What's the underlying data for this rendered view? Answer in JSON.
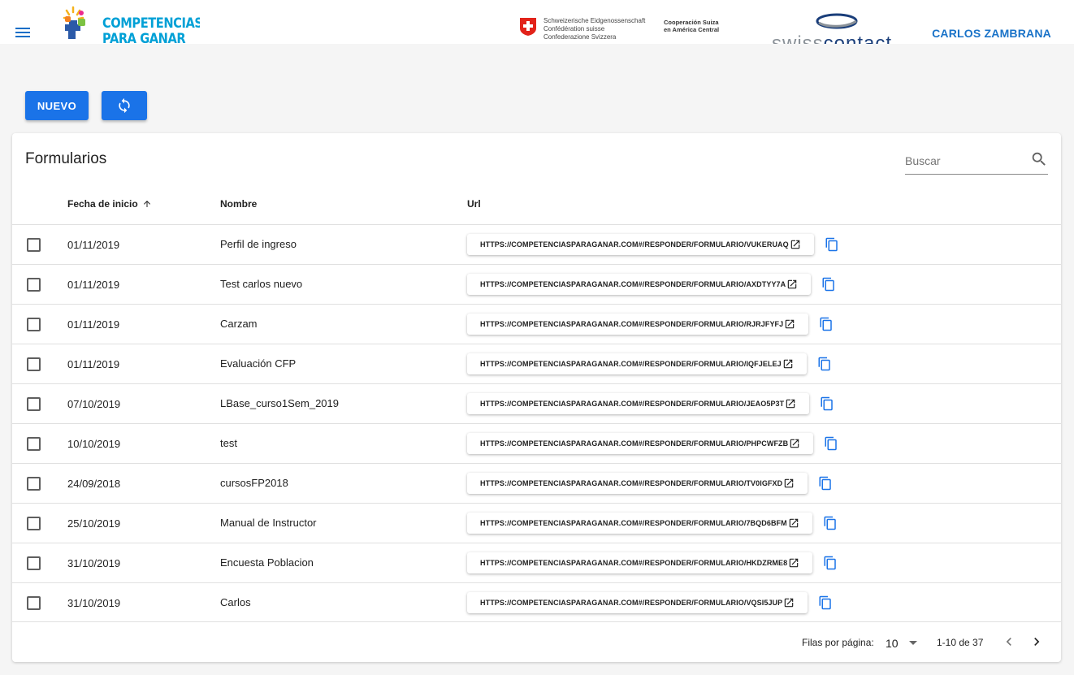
{
  "header": {
    "brand_line1": "COMPETENCIAS",
    "brand_line2": "PARA GANAR",
    "swiss_lines": [
      "Schweizerische Eidgenossenschaft",
      "Confédération suisse",
      "Confederazione Svizzera"
    ],
    "coop_lines": [
      "Cooperación Suiza",
      "en América Central"
    ],
    "swisscontact_a": "swiss",
    "swisscontact_b": "contact",
    "user_name": "CARLOS ZAMBRANA"
  },
  "toolbar": {
    "new_label": "NUEVO",
    "refresh_icon": "refresh-icon"
  },
  "card": {
    "title": "Formularios",
    "search_placeholder": "Buscar",
    "columns": [
      "Fecha de inicio",
      "Nombre",
      "Url"
    ],
    "sort": "ascending",
    "rows": [
      {
        "date": "01/11/2019",
        "name": "Perfil de ingreso",
        "url": "HTTPS://COMPETENCIASPARAGANAR.COM#/RESPONDER/FORMULARIO/VUKERUAQ"
      },
      {
        "date": "01/11/2019",
        "name": "Test carlos nuevo",
        "url": "HTTPS://COMPETENCIASPARAGANAR.COM#/RESPONDER/FORMULARIO/AXDTYY7A"
      },
      {
        "date": "01/11/2019",
        "name": "Carzam",
        "url": "HTTPS://COMPETENCIASPARAGANAR.COM#/RESPONDER/FORMULARIO/RJRJFYFJ"
      },
      {
        "date": "01/11/2019",
        "name": "Evaluación CFP",
        "url": "HTTPS://COMPETENCIASPARAGANAR.COM#/RESPONDER/FORMULARIO/IQFJELEJ"
      },
      {
        "date": "07/10/2019",
        "name": "LBase_curso1Sem_2019",
        "url": "HTTPS://COMPETENCIASPARAGANAR.COM#/RESPONDER/FORMULARIO/JEAO5P3T"
      },
      {
        "date": "10/10/2019",
        "name": "test",
        "url": "HTTPS://COMPETENCIASPARAGANAR.COM#/RESPONDER/FORMULARIO/PHPCWFZB"
      },
      {
        "date": "24/09/2018",
        "name": "cursosFP2018",
        "url": "HTTPS://COMPETENCIASPARAGANAR.COM#/RESPONDER/FORMULARIO/TV0IGFXD"
      },
      {
        "date": "25/10/2019",
        "name": "Manual de Instructor",
        "url": "HTTPS://COMPETENCIASPARAGANAR.COM#/RESPONDER/FORMULARIO/7BQD6BFM"
      },
      {
        "date": "31/10/2019",
        "name": "Encuesta Poblacion",
        "url": "HTTPS://COMPETENCIASPARAGANAR.COM#/RESPONDER/FORMULARIO/HKDZRME8"
      },
      {
        "date": "31/10/2019",
        "name": "Carlos",
        "url": "HTTPS://COMPETENCIASPARAGANAR.COM#/RESPONDER/FORMULARIO/VQSI5JUP"
      }
    ]
  },
  "pagination": {
    "rows_per_page_label": "Filas por página:",
    "rows_per_page_value": "10",
    "range_text": "1-10 de 37"
  },
  "colors": {
    "primary": "#1a73e8",
    "header_text": "#1a73c8",
    "swiss_red": "#e2231a"
  }
}
